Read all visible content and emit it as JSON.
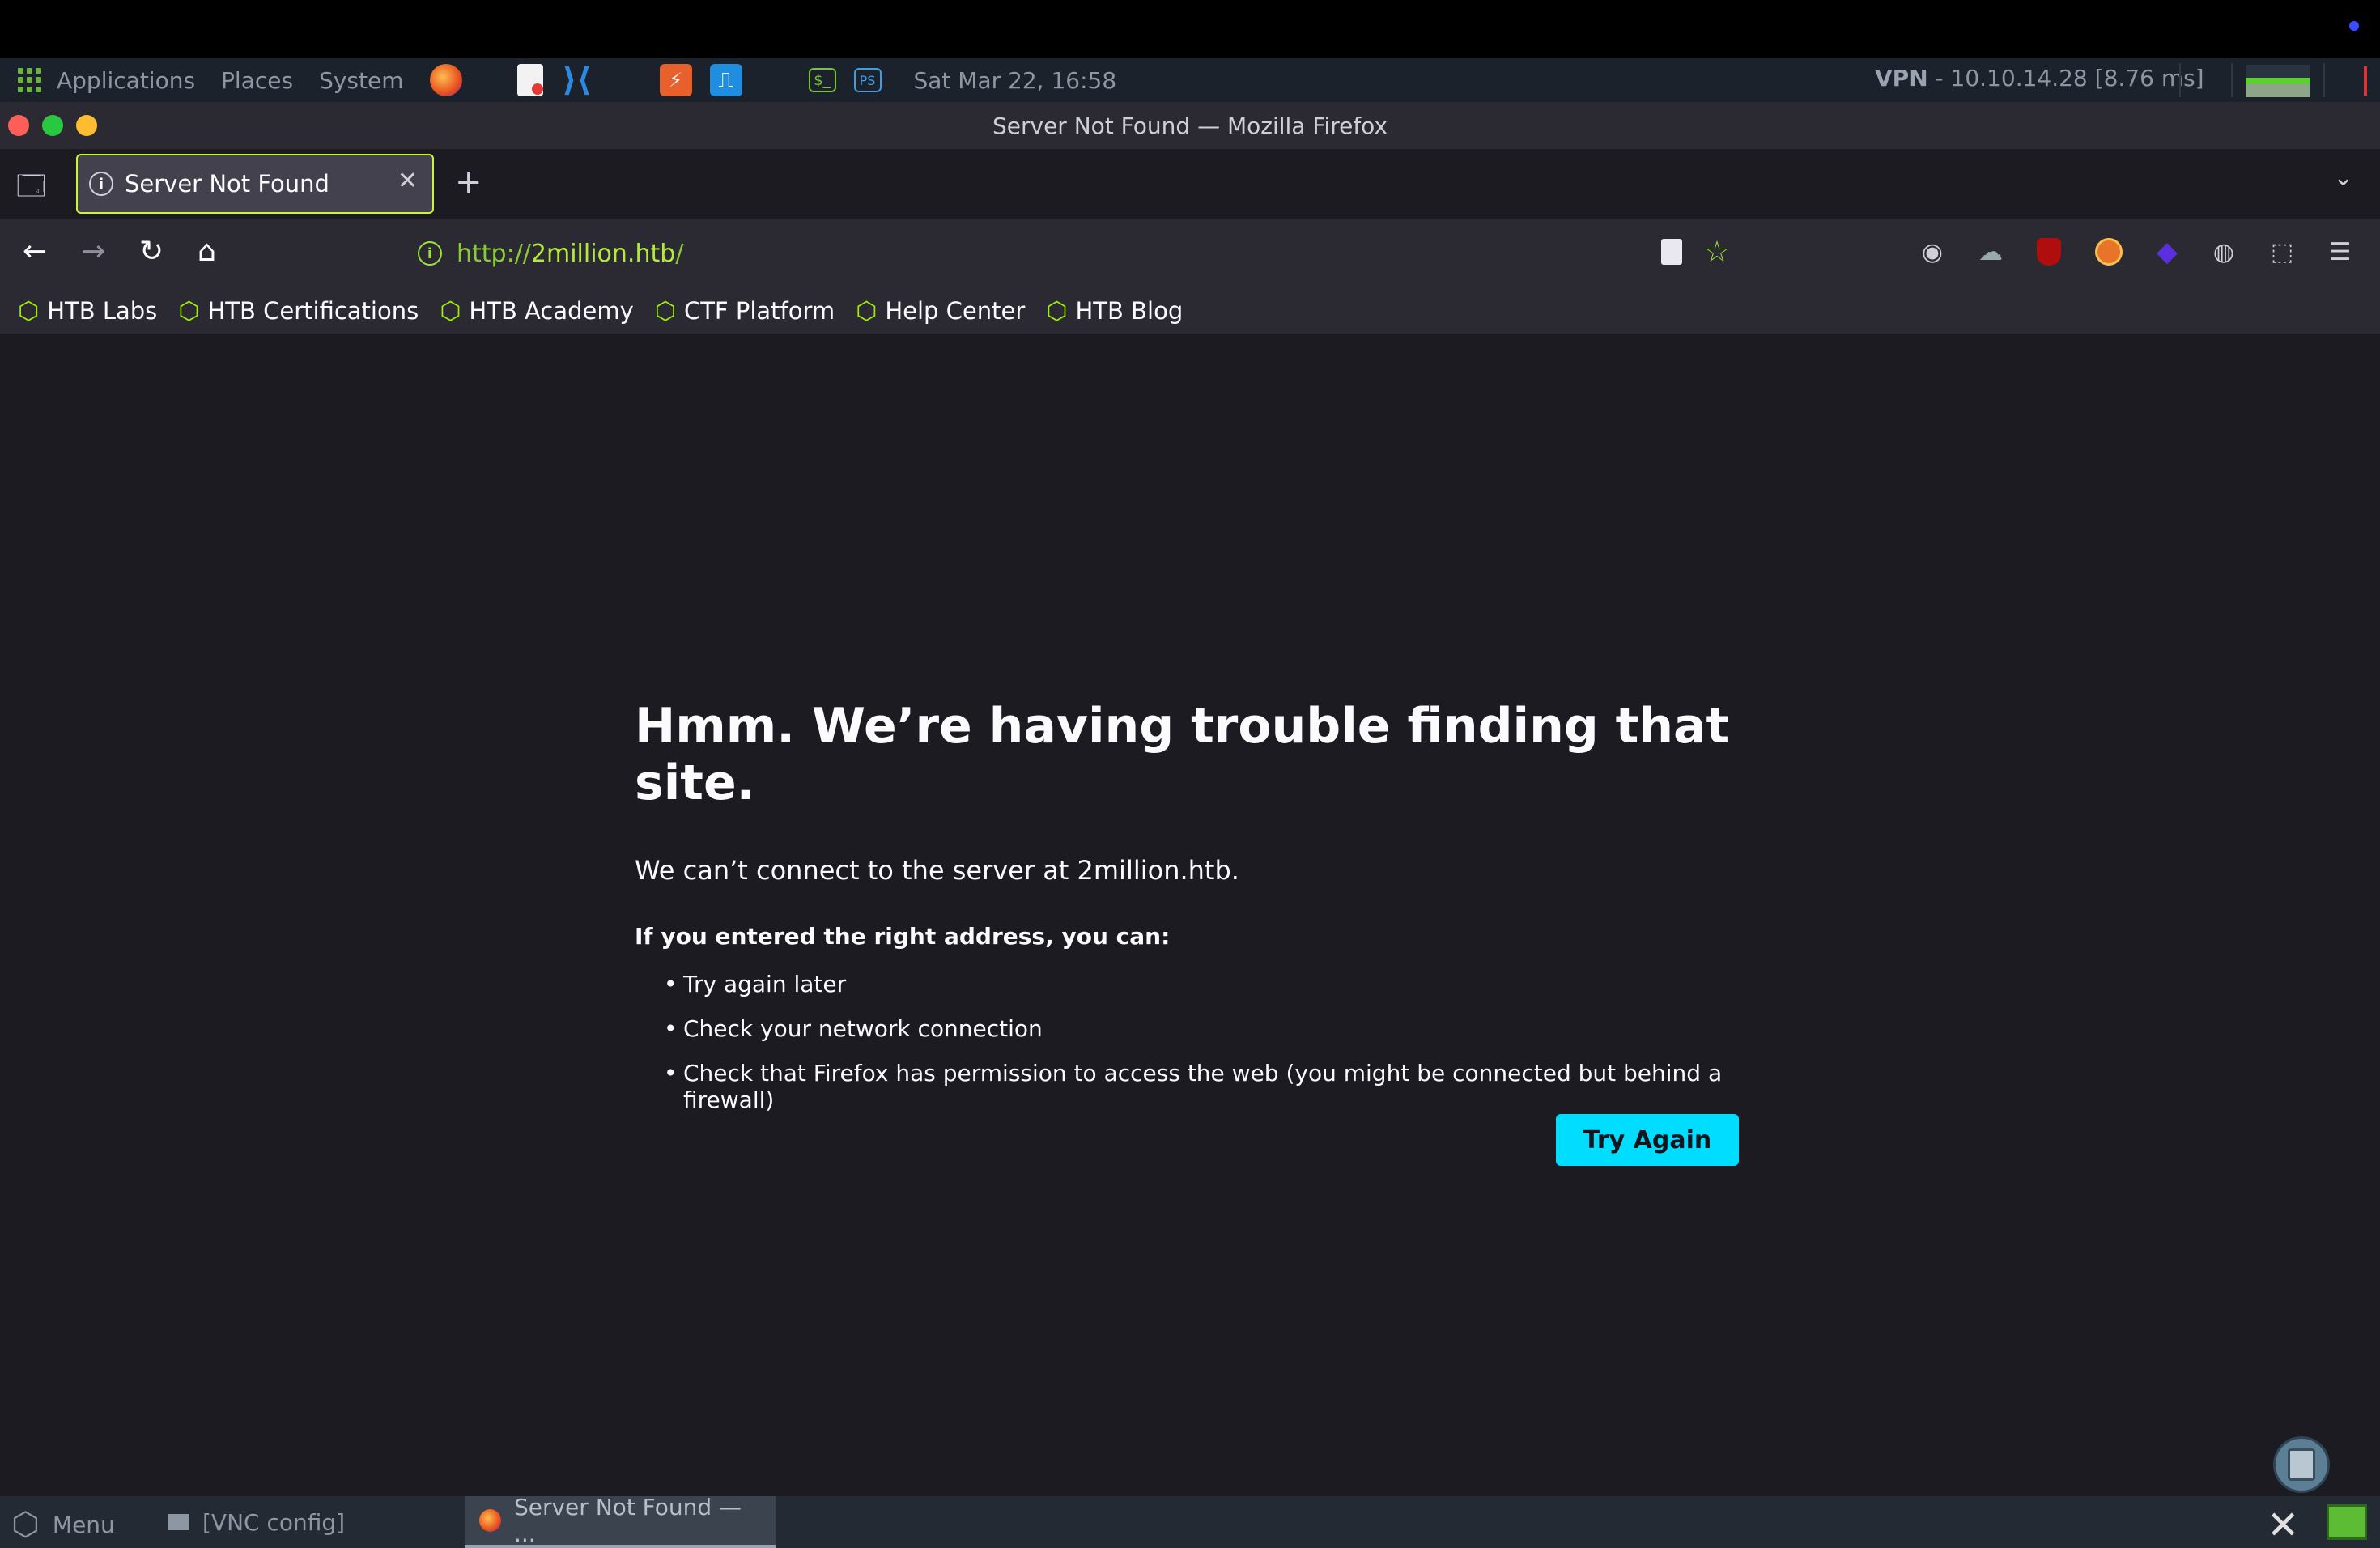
{
  "system_panel": {
    "menus": [
      "Applications",
      "Places",
      "System"
    ],
    "clock": "Sat Mar 22, 16:58",
    "vpn_label": "VPN",
    "vpn_value": " - 10.10.14.28 [8.76 ms]"
  },
  "window": {
    "title": "Server Not Found — Mozilla Firefox"
  },
  "tab": {
    "title": "Server Not Found",
    "close": "✕",
    "new_tab": "+"
  },
  "navbar": {
    "url_scheme": "http://",
    "url_host": "2million.htb",
    "url_path": "/"
  },
  "bookmarks": [
    {
      "label": "HTB Labs"
    },
    {
      "label": "HTB Certifications"
    },
    {
      "label": "HTB Academy"
    },
    {
      "label": "CTF Platform"
    },
    {
      "label": "Help Center"
    },
    {
      "label": "HTB Blog"
    }
  ],
  "error_page": {
    "title": "Hmm. We’re having trouble finding that site.",
    "lead": "We can’t connect to the server at 2million.htb.",
    "subheading": "If you entered the right address, you can:",
    "suggestions": [
      "Try again later",
      "Check your network connection",
      "Check that Firefox has permission to access the web (you might be connected but behind a firewall)"
    ],
    "button": "Try Again"
  },
  "taskbar": {
    "menu_label": "Menu",
    "tasks": [
      "[VNC config]",
      "Server Not Found — ..."
    ]
  },
  "colors": {
    "accent": "#00ddff",
    "bookmark_icon": "#9fef00",
    "tab_border": "#c9f73a"
  }
}
